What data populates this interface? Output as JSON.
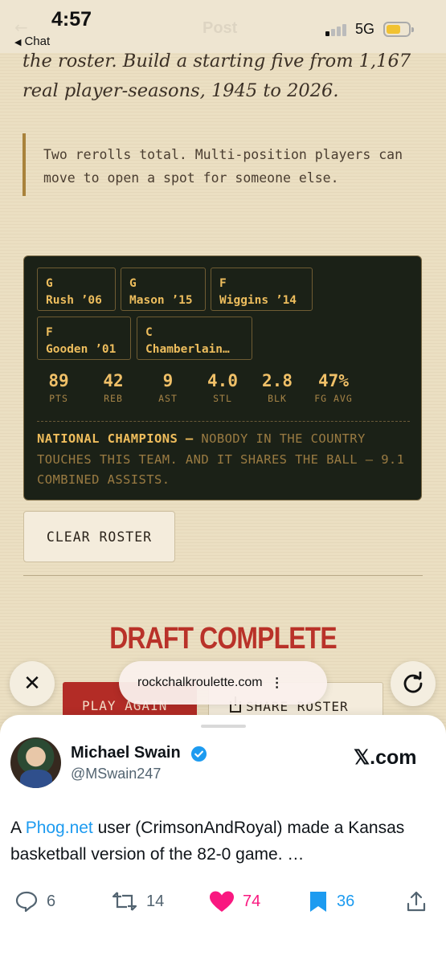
{
  "status_bar": {
    "time": "4:57",
    "back_label": "Chat",
    "network": "5G",
    "ghost_title": "Post"
  },
  "article": {
    "lead": "the roster. Build a starting five from 1,167 real player-seasons, 1945 to 2026.",
    "note": "Two rerolls total. Multi-position players can move to open a spot for someone else."
  },
  "roster": {
    "players": [
      {
        "pos": "G",
        "name": "Rush ’06"
      },
      {
        "pos": "G",
        "name": "Mason ’15"
      },
      {
        "pos": "F",
        "name": "Wiggins ’14"
      },
      {
        "pos": "F",
        "name": "Gooden ’01"
      },
      {
        "pos": "C",
        "name": "Chamberlain…"
      }
    ],
    "stats": [
      {
        "value": "89",
        "label": "PTS"
      },
      {
        "value": "42",
        "label": "REB"
      },
      {
        "value": "9",
        "label": "AST"
      },
      {
        "value": "4.0",
        "label": "STL"
      },
      {
        "value": "2.8",
        "label": "BLK"
      },
      {
        "value": "47%",
        "label": "FG AVG"
      }
    ],
    "verdict_title": "NATIONAL CHAMPIONS —",
    "verdict_text": " NOBODY IN THE COUNTRY TOUCHES THIS TEAM. AND IT SHARES THE BALL — 9.1 COMBINED ASSISTS."
  },
  "buttons": {
    "clear_roster": "CLEAR ROSTER",
    "play_again": "PLAY AGAIN",
    "share_roster": "SHARE ROSTER"
  },
  "draft_title": "DRAFT COMPLETE",
  "browser": {
    "url": "rockchalkroulette.com"
  },
  "tweet": {
    "name": "Michael Swain",
    "handle": "@MSwain247",
    "site": "𝕏.com",
    "text_before": "A ",
    "link": "Phog.net",
    "text_after": " user (CrimsonAndRoyal) made a Kansas basketball version of the 82-0 game. …",
    "replies": "6",
    "reposts": "14",
    "likes": "74",
    "bookmarks": "36"
  },
  "colors": {
    "page_bg": "#ebdfc2",
    "card_bg": "#1b2117",
    "card_gold": "#e7b95a",
    "accent_red": "#b32c26",
    "like_pink": "#f91880",
    "link_blue": "#1d9bf0"
  }
}
